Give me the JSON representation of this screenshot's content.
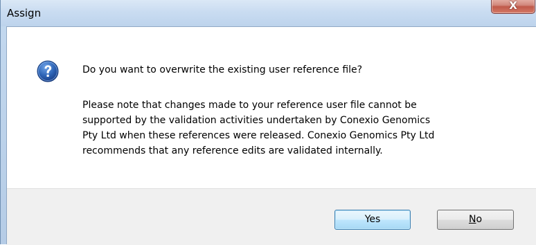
{
  "window": {
    "title": "Assign",
    "close_label": "X"
  },
  "dialog": {
    "icon": "question-icon",
    "question": "Do you want to overwrite the existing user reference file?",
    "note_lines": [
      "Please note that changes made to your reference user file cannot be",
      "supported by the validation activities undertaken by Conexio Genomics",
      "Pty Ltd when these references were released. Conexio Genomics Pty Ltd",
      "recommends that any reference edits are validated internally."
    ]
  },
  "buttons": {
    "yes_label": "Yes",
    "no_label_mnemonic": "N",
    "no_label_rest": "o"
  },
  "colors": {
    "title_bar": "#c9dcf1",
    "close_button": "#c0594a",
    "button_bar": "#f0f0f0",
    "default_button_border": "#3c7fb1",
    "question_icon": "#2d63b5"
  }
}
